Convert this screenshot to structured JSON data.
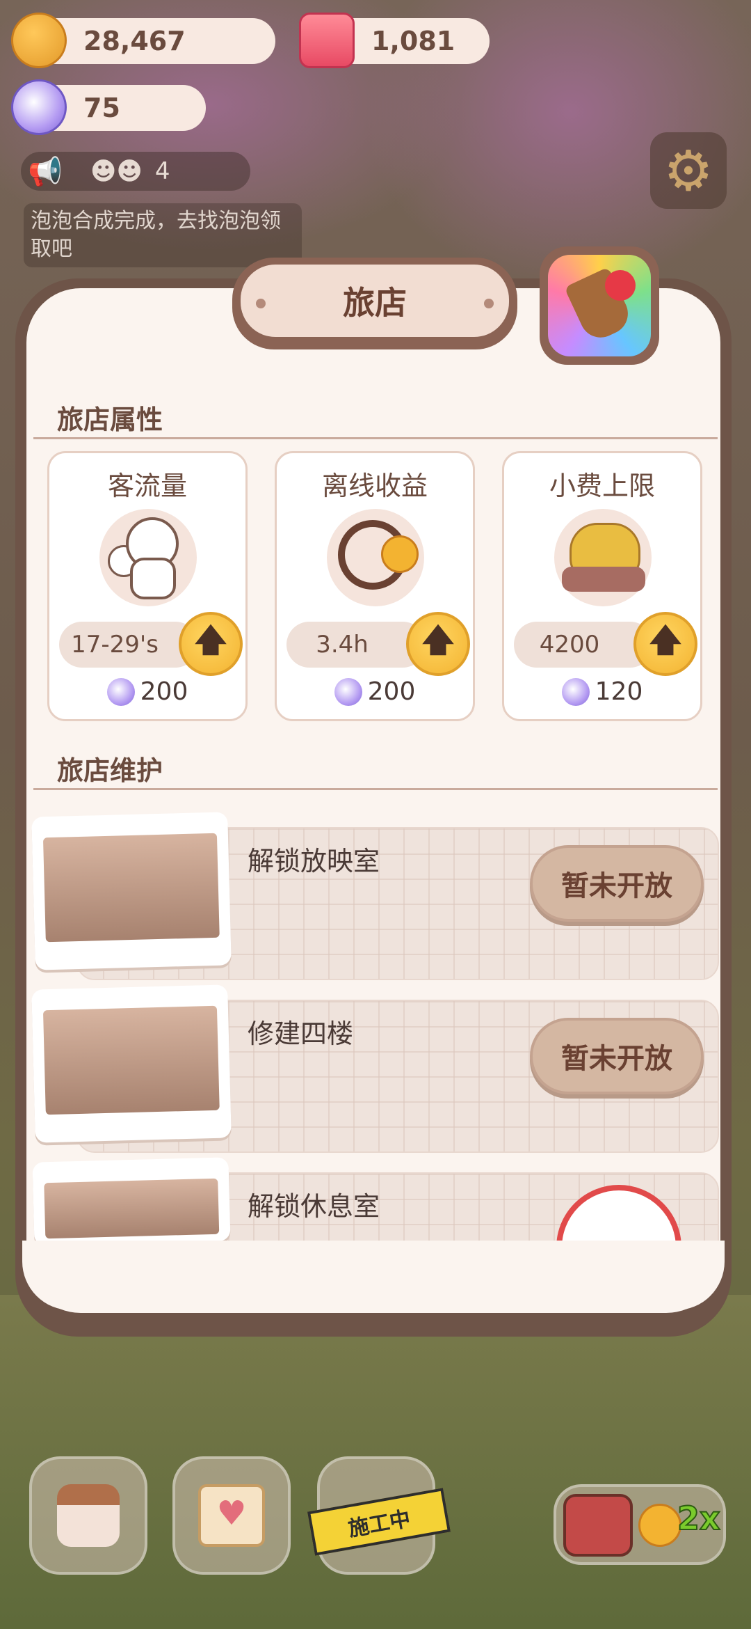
{
  "currencies": {
    "cookies": "28,467",
    "jelly": "1,081",
    "candy": "75"
  },
  "notice": {
    "count": "4",
    "message": "泡泡合成完成，去找泡泡领取吧"
  },
  "panel": {
    "title": "旅店",
    "attributes_title": "旅店属性",
    "maintenance_title": "旅店维护",
    "attributes": [
      {
        "label": "客流量",
        "value": "17-29's",
        "cost": "200",
        "icon": "people-icon"
      },
      {
        "label": "离线收益",
        "value": "3.4h",
        "cost": "200",
        "icon": "clock-icon"
      },
      {
        "label": "小费上限",
        "value": "4200",
        "cost": "120",
        "icon": "piggy-bank-icon"
      }
    ],
    "maintenance": [
      {
        "title": "解锁放映室",
        "button": "暂未开放"
      },
      {
        "title": "修建四楼",
        "button": "暂未开放"
      },
      {
        "title": "解锁休息室",
        "button": ""
      }
    ]
  },
  "bottom_bar": {
    "construction_label": "施工中",
    "boost_multiplier": "2x"
  },
  "colors": {
    "panel_border": "#6e5448",
    "panel_bg": "#fbf4ef",
    "upgrade_button": "#f3b331",
    "locked_button": "#d4b7a2"
  }
}
